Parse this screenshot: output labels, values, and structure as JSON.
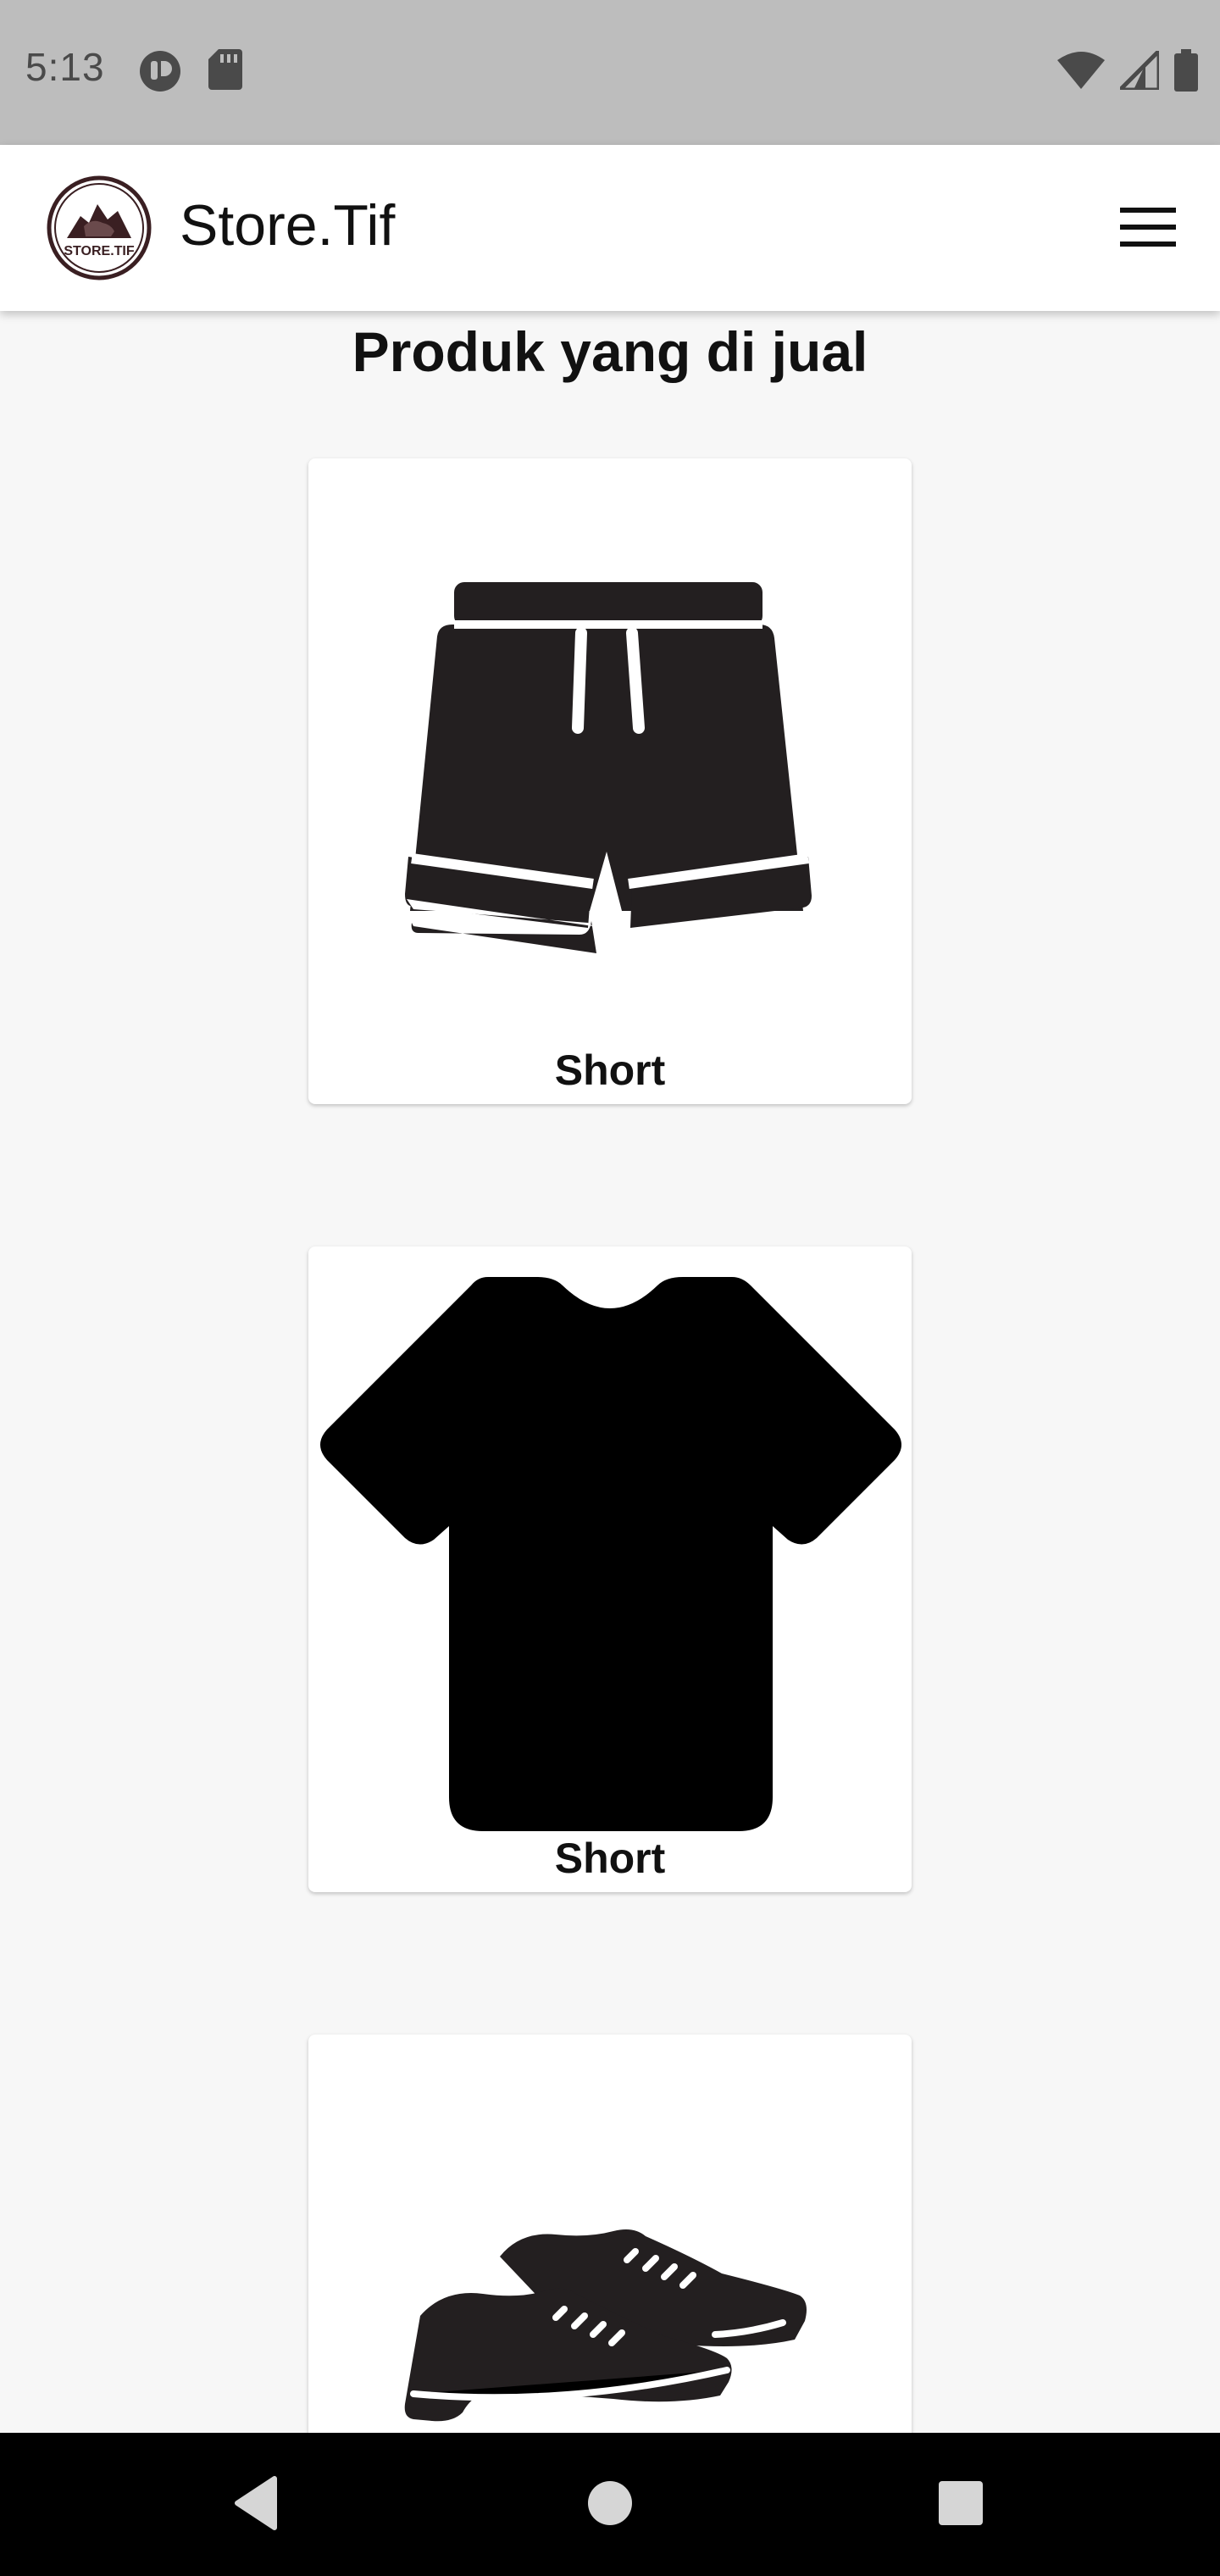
{
  "status_bar": {
    "time": "5:13",
    "left_icons": [
      "notification-icon",
      "sd-card-icon"
    ],
    "right_icons": [
      "wifi-icon",
      "cell-signal-icon",
      "battery-icon"
    ]
  },
  "app_bar": {
    "logo_text": "STORE.TIF",
    "title": "Store.Tif",
    "menu_icon": "hamburger-menu-icon"
  },
  "main": {
    "heading": "Produk yang di jual",
    "products": [
      {
        "label": "Short",
        "icon": "shorts-icon"
      },
      {
        "label": "Short",
        "icon": "tshirt-icon"
      },
      {
        "label": "",
        "icon": "shoes-icon"
      }
    ]
  },
  "nav_bar": {
    "buttons": [
      "back-icon",
      "home-icon",
      "recents-icon"
    ]
  },
  "colors": {
    "status_bar": "#bdbdbd",
    "app_bar": "#ffffff",
    "background": "#f7f7f7",
    "logo_ring": "#3a1f22",
    "nav_bar": "#000000"
  }
}
